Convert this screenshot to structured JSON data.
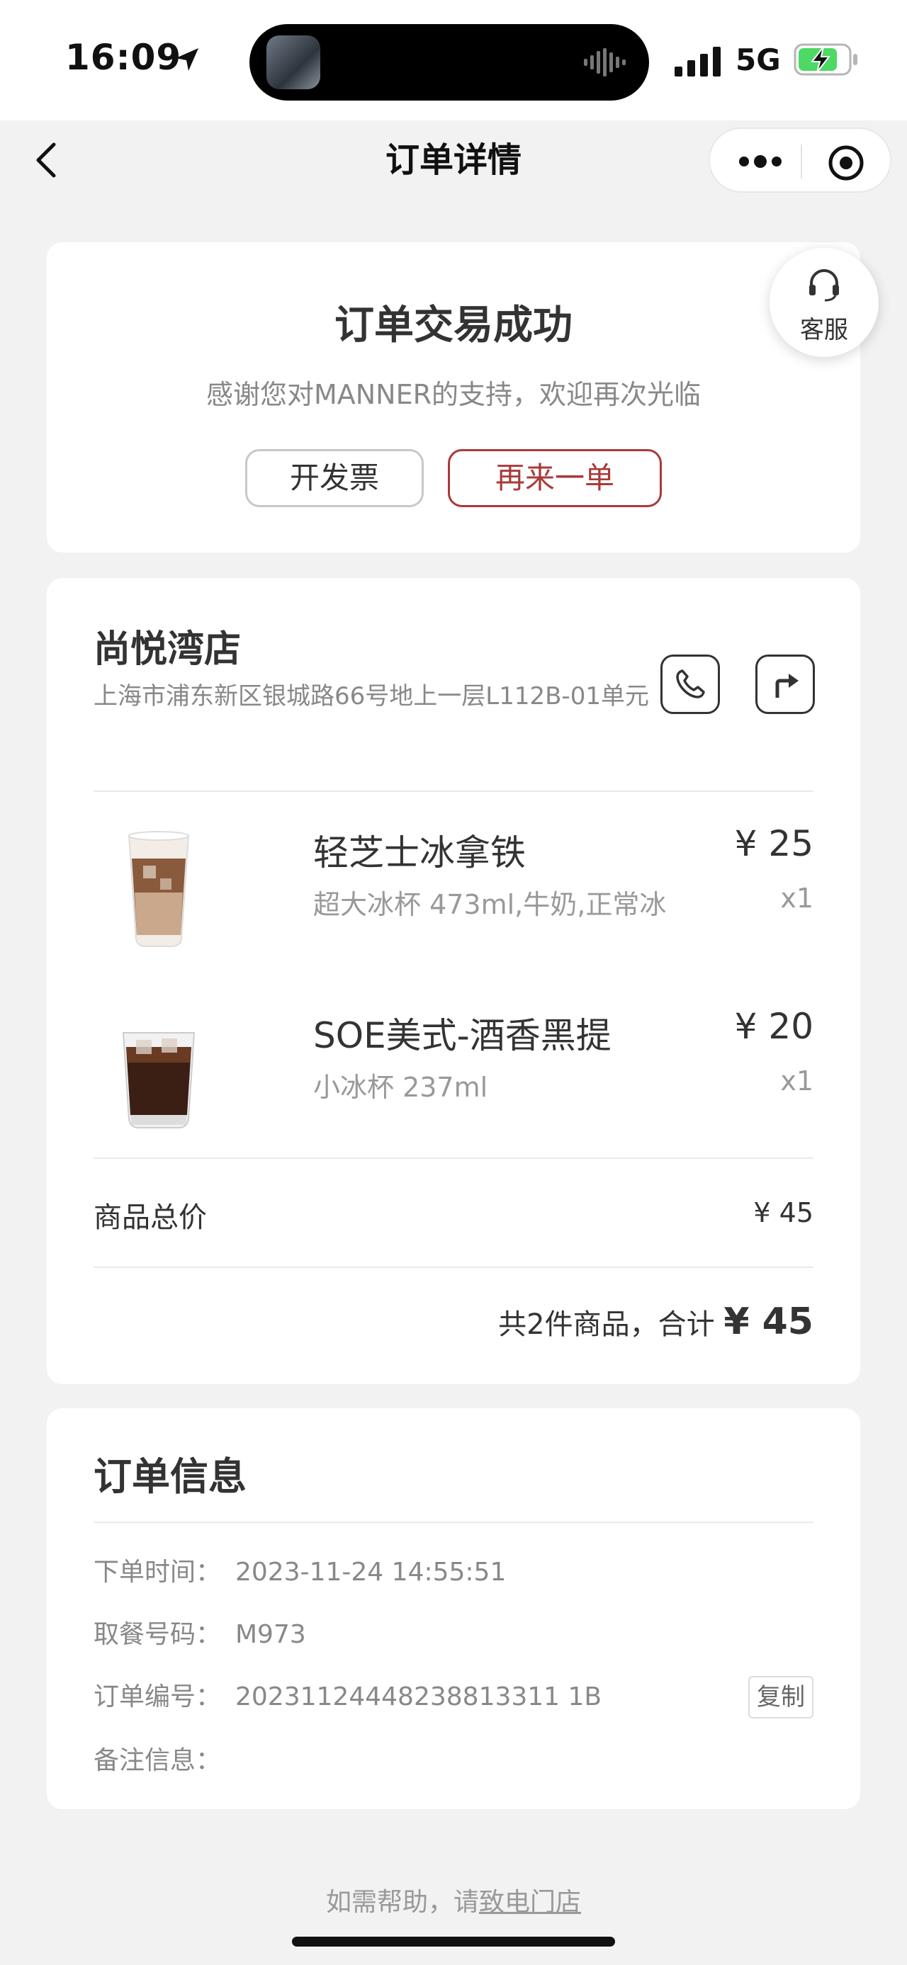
{
  "status_bar": {
    "time": "16:09",
    "network": "5G"
  },
  "nav": {
    "title": "订单详情"
  },
  "service": {
    "label": "客服"
  },
  "status_card": {
    "title": "订单交易成功",
    "subtitle": "感谢您对MANNER的支持，欢迎再次光临",
    "invoice_btn": "开发票",
    "reorder_btn": "再来一单"
  },
  "store": {
    "name": "尚悦湾店",
    "address": "上海市浦东新区银城路66号地上一层L112B-01单元"
  },
  "items": [
    {
      "name": "轻芝士冰拿铁",
      "spec": "超大冰杯 473ml,牛奶,正常冰",
      "price": "¥ 25",
      "qty": "x1"
    },
    {
      "name": "SOE美式-酒香黑提",
      "spec": "小冰杯 237ml",
      "price": "¥ 20",
      "qty": "x1"
    }
  ],
  "summary": {
    "subtotal_label": "商品总价",
    "subtotal_value": "¥ 45",
    "total_prefix": "共2件商品，合计 ",
    "total_amount": "¥ 45"
  },
  "order_info": {
    "title": "订单信息",
    "rows": [
      {
        "label": "下单时间：",
        "value": "2023-11-24 14:55:51"
      },
      {
        "label": "取餐号码：",
        "value": "M973"
      },
      {
        "label": "订单编号：",
        "value": "20231124448238813311 1B"
      },
      {
        "label": "备注信息：",
        "value": ""
      }
    ],
    "copy_btn": "复制"
  },
  "footer": {
    "help_text": "如需帮助，请",
    "help_link": "致电门店"
  },
  "colors": {
    "accent": "#a93a3a",
    "background": "#f2f2f2",
    "battery": "#4cd964"
  }
}
